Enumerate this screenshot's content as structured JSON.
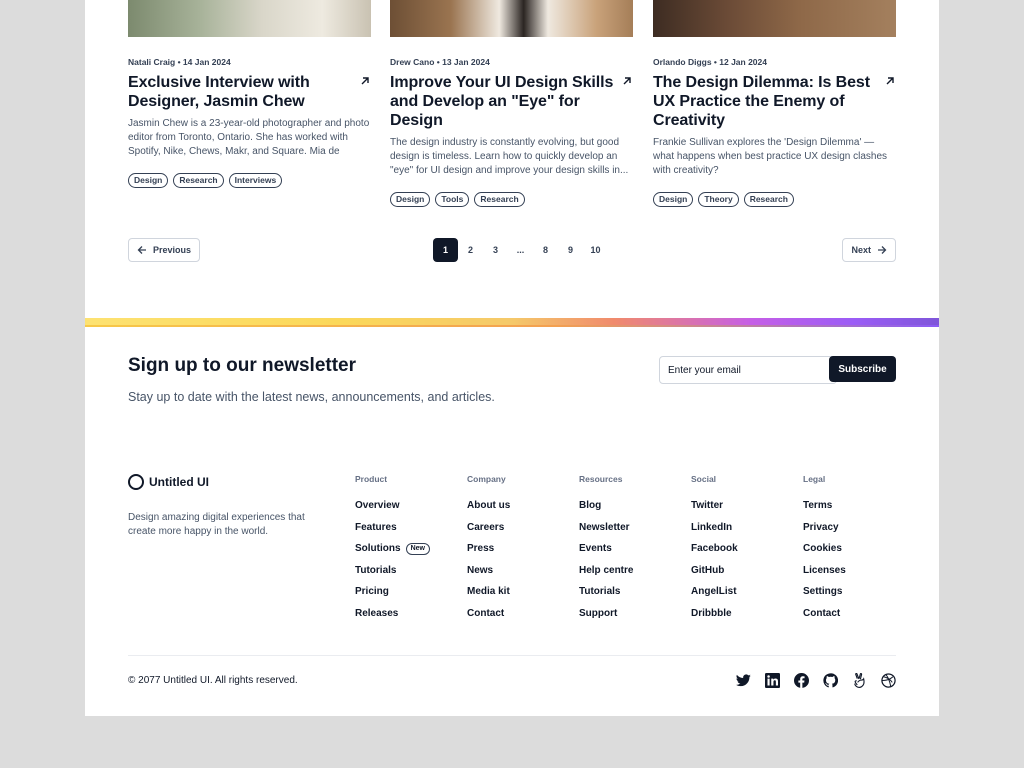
{
  "cards": [
    {
      "meta": "Natali Craig • 14 Jan 2024",
      "title": "Exclusive Interview with Designer, Jasmin Chew",
      "description": "Jasmin Chew is a 23-year-old photographer and photo editor from Toronto, Ontario. She has worked with Spotify, Nike, Chews, Makr, and Square. Mia de Silva...",
      "tags": [
        "Design",
        "Research",
        "Interviews"
      ]
    },
    {
      "meta": "Drew Cano • 13 Jan 2024",
      "title": "Improve Your UI Design Skills and Develop an \"Eye\" for Design",
      "description": "The design industry is constantly evolving, but good design is timeless. Learn how to quickly develop an \"eye\" for UI design and improve your design skills in...",
      "tags": [
        "Design",
        "Tools",
        "Research"
      ]
    },
    {
      "meta": "Orlando Diggs • 12 Jan 2024",
      "title": "The Design Dilemma: Is Best UX Practice the Enemy of Creativity",
      "description": "Frankie Sullivan explores the 'Design Dilemma' — what happens when best practice UX design clashes with creativity?",
      "tags": [
        "Design",
        "Theory",
        "Research"
      ]
    }
  ],
  "pagination": {
    "previous": "Previous",
    "next": "Next",
    "pages": [
      "1",
      "2",
      "3",
      "...",
      "8",
      "9",
      "10"
    ],
    "current": "1"
  },
  "newsletter": {
    "title": "Sign up to our newsletter",
    "subtitle": "Stay up to date with the latest news, announcements, and articles.",
    "placeholder": "Enter your email",
    "button": "Subscribe"
  },
  "footer": {
    "brand": "Untitled UI",
    "description": "Design amazing digital experiences that create more happy in the world.",
    "columns": [
      {
        "heading": "Product",
        "links": [
          {
            "label": "Overview"
          },
          {
            "label": "Features"
          },
          {
            "label": "Solutions",
            "badge": "New"
          },
          {
            "label": "Tutorials"
          },
          {
            "label": "Pricing"
          },
          {
            "label": "Releases"
          }
        ]
      },
      {
        "heading": "Company",
        "links": [
          {
            "label": "About us"
          },
          {
            "label": "Careers"
          },
          {
            "label": "Press"
          },
          {
            "label": "News"
          },
          {
            "label": "Media kit"
          },
          {
            "label": "Contact"
          }
        ]
      },
      {
        "heading": "Resources",
        "links": [
          {
            "label": "Blog"
          },
          {
            "label": "Newsletter"
          },
          {
            "label": "Events"
          },
          {
            "label": "Help centre"
          },
          {
            "label": "Tutorials"
          },
          {
            "label": "Support"
          }
        ]
      },
      {
        "heading": "Social",
        "links": [
          {
            "label": "Twitter"
          },
          {
            "label": "LinkedIn"
          },
          {
            "label": "Facebook"
          },
          {
            "label": "GitHub"
          },
          {
            "label": "AngelList"
          },
          {
            "label": "Dribbble"
          }
        ]
      },
      {
        "heading": "Legal",
        "links": [
          {
            "label": "Terms"
          },
          {
            "label": "Privacy"
          },
          {
            "label": "Cookies"
          },
          {
            "label": "Licenses"
          },
          {
            "label": "Settings"
          },
          {
            "label": "Contact"
          }
        ]
      }
    ],
    "copyright": "© 2077 Untitled UI. All rights reserved.",
    "social_icons": [
      "twitter-icon",
      "linkedin-icon",
      "facebook-icon",
      "github-icon",
      "angellist-icon",
      "dribbble-icon"
    ]
  },
  "colors": {
    "primary": "#101828",
    "text_secondary": "#475467",
    "border": "#d0d5dd",
    "gradient": [
      "#fde272",
      "#f08a6c",
      "#9b5cf6"
    ]
  }
}
